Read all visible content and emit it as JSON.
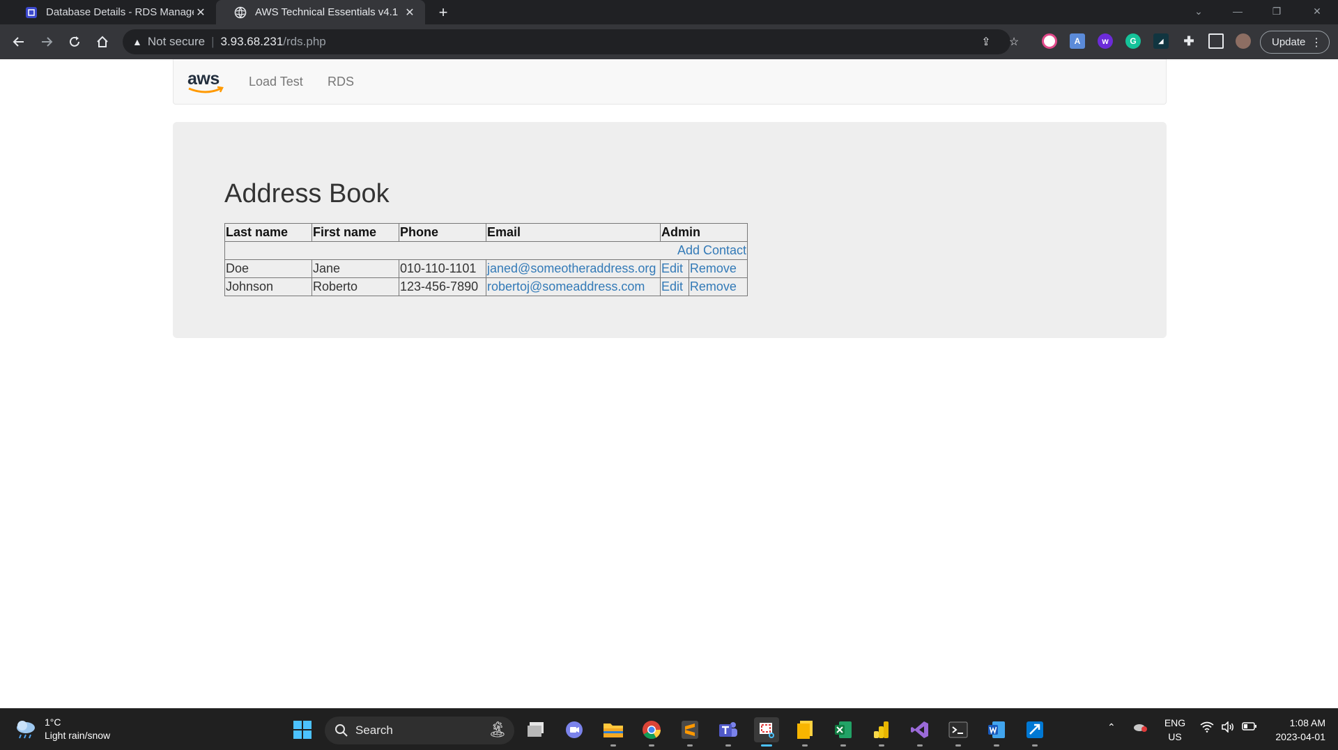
{
  "browser": {
    "tabs": [
      {
        "title": "Database Details - RDS Managem",
        "icon": "rds-favicon"
      },
      {
        "title": "AWS Technical Essentials v4.1",
        "icon": "globe-icon"
      }
    ],
    "address": {
      "security_label": "Not secure",
      "host": "3.93.68.231",
      "path": "/rds.php"
    },
    "update_label": "Update"
  },
  "page": {
    "brand": "aws",
    "nav": [
      "Load Test",
      "RDS"
    ],
    "title": "Address Book",
    "table": {
      "headers": [
        "Last name",
        "First name",
        "Phone",
        "Email",
        "Admin"
      ],
      "add_contact": "Add Contact",
      "rows": [
        {
          "last": "Doe",
          "first": "Jane",
          "phone": "010-110-1101",
          "email": "janed@someotheraddress.org",
          "edit": "Edit",
          "remove": "Remove"
        },
        {
          "last": "Johnson",
          "first": "Roberto",
          "phone": "123-456-7890",
          "email": "robertoj@someaddress.com",
          "edit": "Edit",
          "remove": "Remove"
        }
      ]
    }
  },
  "taskbar": {
    "weather": {
      "temp": "1°C",
      "condition": "Light rain/snow"
    },
    "search_label": "Search",
    "lang": {
      "line1": "ENG",
      "line2": "US"
    },
    "clock": {
      "time": "1:08 AM",
      "date": "2023-04-01"
    }
  }
}
